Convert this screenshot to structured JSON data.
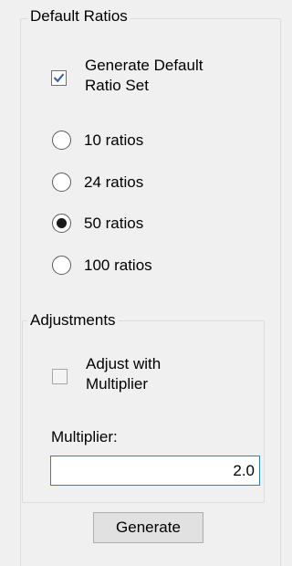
{
  "default_ratios": {
    "title": "Default Ratios",
    "generate_default": {
      "label": "Generate Default Ratio Set",
      "line1": "Generate Default",
      "line2": "Ratio Set",
      "checked": true,
      "check_color": "#3261a8"
    },
    "options": [
      {
        "label": "10 ratios",
        "selected": false
      },
      {
        "label": "24 ratios",
        "selected": false
      },
      {
        "label": "50 ratios",
        "selected": true
      },
      {
        "label": "100 ratios",
        "selected": false
      }
    ]
  },
  "adjustments": {
    "title": "Adjustments",
    "adjust_with_multiplier": {
      "label": "Adjust with Multiplier",
      "line1": "Adjust with",
      "line2": "Multiplier",
      "checked": false,
      "enabled": false
    },
    "multiplier_label": "Multiplier:",
    "multiplier_value": "2.0"
  },
  "generate_button": "Generate",
  "colors": {
    "background": "#f0f0f0",
    "group_border": "#dcdcdc",
    "focus_border": "#2e7fc7",
    "button_face": "#e1e1e1"
  }
}
